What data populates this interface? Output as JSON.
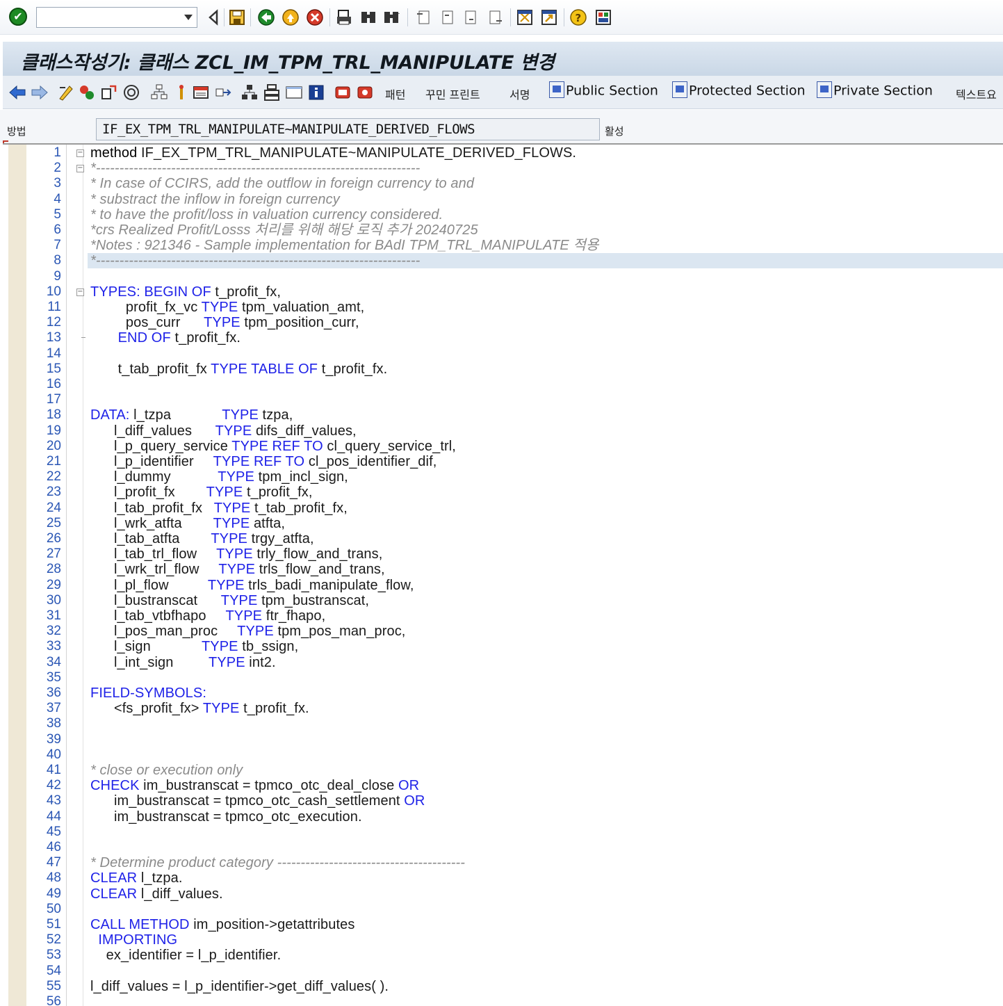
{
  "system_toolbar": {
    "ok_icon": "check-icon",
    "command_field_value": "",
    "icons": [
      "back-icon",
      "save-icon",
      "green-back-icon",
      "exit-icon",
      "cancel-icon",
      "print-icon",
      "find-icon",
      "find-next-icon",
      "first-page-icon",
      "prev-page-icon",
      "next-page-icon",
      "last-page-icon",
      "new-session-icon",
      "shortcut-icon",
      "help-icon",
      "customize-layout-icon"
    ]
  },
  "title": "클래스작성기: 클래스 ZCL_IM_TPM_TRL_MANIPULATE 변경",
  "app_toolbar": {
    "pattern_label": "패턴",
    "pretty_print_label": "꾸민 프린트",
    "signature_label": "서명",
    "public_section_label": "Public Section",
    "protected_section_label": "Protected Section",
    "private_section_label": "Private Section",
    "text_elements_label": "텍스트요"
  },
  "method_row": {
    "label": "방법",
    "value": "IF_EX_TPM_TRL_MANIPULATE~MANIPULATE_DERIVED_FLOWS",
    "status": "활성"
  },
  "editor": {
    "highlight_color": "#dbe6f1",
    "keyword_color": "#1f22e8",
    "comment_color": "#8a8a8a",
    "lines": [
      {
        "n": "1",
        "html": "<span class=\"bd\">method</span> IF_EX_TPM_TRL_MANIPULATE~MANIPULATE_DERIVED_FLOWS."
      },
      {
        "n": "2",
        "html": "<span class=\"cm\">*---------------------------------------------------------------------</span>"
      },
      {
        "n": "3",
        "html": "<span class=\"cm\">* In case of CCIRS, add the outflow in foreign currency to and</span>"
      },
      {
        "n": "4",
        "html": "<span class=\"cm\">* substract the inflow in foreign currency</span>"
      },
      {
        "n": "5",
        "html": "<span class=\"cm\">* to have the profit/loss in valuation currency considered.</span>"
      },
      {
        "n": "6",
        "html": "<span class=\"cm\">*crs Realized Profit/Losss 처리를 위해 해당 로직 추가 20240725</span>"
      },
      {
        "n": "7",
        "html": "<span class=\"cm\">*Notes : 921346 - Sample implementation for BAdI TPM_TRL_MANIPULATE 적용</span>"
      },
      {
        "n": "8",
        "html": "<span class=\"cm\">*---------------------------------------------------------------------</span>"
      },
      {
        "n": "9",
        "html": ""
      },
      {
        "n": "10",
        "html": "<span class=\"kw\">TYPES: BEGIN OF</span> t_profit_fx,"
      },
      {
        "n": "11",
        "html": "         profit_fx_vc <span class=\"kw\">TYPE</span> tpm_valuation_amt,"
      },
      {
        "n": "12",
        "html": "         pos_curr      <span class=\"kw\">TYPE</span> tpm_position_curr,"
      },
      {
        "n": "13",
        "html": "       <span class=\"kw\">END OF</span> t_profit_fx."
      },
      {
        "n": "14",
        "html": ""
      },
      {
        "n": "15",
        "html": "       t_tab_profit_fx <span class=\"kw\">TYPE TABLE OF</span> t_profit_fx."
      },
      {
        "n": "16",
        "html": ""
      },
      {
        "n": "17",
        "html": ""
      },
      {
        "n": "18",
        "html": "<span class=\"kw\">DATA:</span> l_tzpa             <span class=\"kw\">TYPE</span> tzpa,"
      },
      {
        "n": "19",
        "html": "      l_diff_values      <span class=\"kw\">TYPE</span> difs_diff_values,"
      },
      {
        "n": "20",
        "html": "      l_p_query_service <span class=\"kw\">TYPE REF TO</span> cl_query_service_trl,"
      },
      {
        "n": "21",
        "html": "      l_p_identifier     <span class=\"kw\">TYPE REF TO</span> cl_pos_identifier_dif,"
      },
      {
        "n": "22",
        "html": "      l_dummy            <span class=\"kw\">TYPE</span> tpm_incl_sign,"
      },
      {
        "n": "23",
        "html": "      l_profit_fx        <span class=\"kw\">TYPE</span> t_profit_fx,"
      },
      {
        "n": "24",
        "html": "      l_tab_profit_fx   <span class=\"kw\">TYPE</span> t_tab_profit_fx,"
      },
      {
        "n": "25",
        "html": "      l_wrk_atfta        <span class=\"kw\">TYPE</span> atfta,"
      },
      {
        "n": "26",
        "html": "      l_tab_atfta        <span class=\"kw\">TYPE</span> trgy_atfta,"
      },
      {
        "n": "27",
        "html": "      l_tab_trl_flow     <span class=\"kw\">TYPE</span> trly_flow_and_trans,"
      },
      {
        "n": "28",
        "html": "      l_wrk_trl_flow     <span class=\"kw\">TYPE</span> trls_flow_and_trans,"
      },
      {
        "n": "29",
        "html": "      l_pl_flow          <span class=\"kw\">TYPE</span> trls_badi_manipulate_flow,"
      },
      {
        "n": "30",
        "html": "      l_bustranscat      <span class=\"kw\">TYPE</span> tpm_bustranscat,"
      },
      {
        "n": "31",
        "html": "      l_tab_vtbfhapo     <span class=\"kw\">TYPE</span> ftr_fhapo,"
      },
      {
        "n": "32",
        "html": "      l_pos_man_proc     <span class=\"kw\">TYPE</span> tpm_pos_man_proc,"
      },
      {
        "n": "33",
        "html": "      l_sign             <span class=\"kw\">TYPE</span> tb_ssign,"
      },
      {
        "n": "34",
        "html": "      l_int_sign         <span class=\"kw\">TYPE</span> int2."
      },
      {
        "n": "35",
        "html": ""
      },
      {
        "n": "36",
        "html": "<span class=\"kw\">FIELD-SYMBOLS:</span>"
      },
      {
        "n": "37",
        "html": "      &lt;fs_profit_fx&gt; <span class=\"kw\">TYPE</span> t_profit_fx."
      },
      {
        "n": "38",
        "html": ""
      },
      {
        "n": "39",
        "html": ""
      },
      {
        "n": "40",
        "html": ""
      },
      {
        "n": "41",
        "html": "<span class=\"cm\">* close or execution only</span>"
      },
      {
        "n": "42",
        "html": "<span class=\"kw\">CHECK</span> im_bustranscat = tpmco_otc_deal_close <span class=\"kw\">OR</span>"
      },
      {
        "n": "43",
        "html": "      im_bustranscat = tpmco_otc_cash_settlement <span class=\"kw\">OR</span>"
      },
      {
        "n": "44",
        "html": "      im_bustranscat = tpmco_otc_execution."
      },
      {
        "n": "45",
        "html": ""
      },
      {
        "n": "46",
        "html": ""
      },
      {
        "n": "47",
        "html": "<span class=\"cm\">* Determine product category ----------------------------------------</span>"
      },
      {
        "n": "48",
        "html": "<span class=\"kw\">CLEAR</span> l_tzpa."
      },
      {
        "n": "49",
        "html": "<span class=\"kw\">CLEAR</span> l_diff_values."
      },
      {
        "n": "50",
        "html": ""
      },
      {
        "n": "51",
        "html": "<span class=\"kw\">CALL METHOD</span> im_position-&gt;getattributes"
      },
      {
        "n": "52",
        "html": "  <span class=\"kw\">IMPORTING</span>"
      },
      {
        "n": "53",
        "html": "    ex_identifier = l_p_identifier."
      },
      {
        "n": "54",
        "html": ""
      },
      {
        "n": "55",
        "html": "l_diff_values = l_p_identifier-&gt;get_diff_values( )."
      },
      {
        "n": "56",
        "html": ""
      }
    ]
  }
}
